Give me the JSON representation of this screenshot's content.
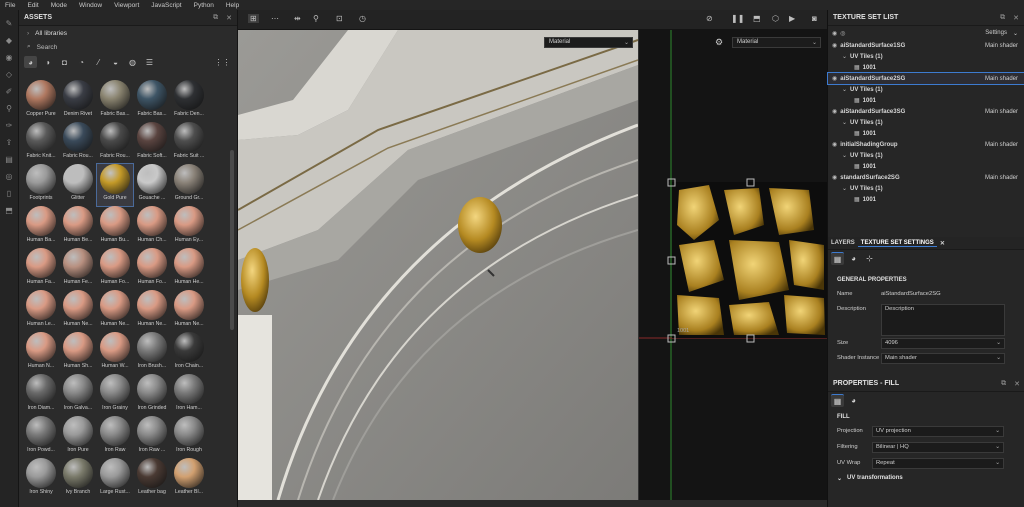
{
  "menu": [
    "File",
    "Edit",
    "Mode",
    "Window",
    "Viewport",
    "JavaScript",
    "Python",
    "Help"
  ],
  "assets": {
    "title": "ASSETS",
    "libraries_label": "All libraries",
    "search_placeholder": "Search",
    "materials": [
      {
        "label": "Copper Pure",
        "color": "#b07860"
      },
      {
        "label": "Denim Rivet",
        "color": "#3a3d45"
      },
      {
        "label": "Fabric Bas...",
        "color": "#8a8470"
      },
      {
        "label": "Fabric Bas...",
        "color": "#3e5566"
      },
      {
        "label": "Fabric Den...",
        "color": "#2e3033"
      },
      {
        "label": "Fabric Knit...",
        "color": "#5a5a5a"
      },
      {
        "label": "Fabric Rou...",
        "color": "#3a4a5a"
      },
      {
        "label": "Fabric Rou...",
        "color": "#4a4a4a"
      },
      {
        "label": "Fabric Soft...",
        "color": "#5a4440"
      },
      {
        "label": "Fabric Suit ...",
        "color": "#4e4e4e"
      },
      {
        "label": "Footprints",
        "color": "#9a9a9a"
      },
      {
        "label": "Glitter",
        "color": "#bdbdbd"
      },
      {
        "label": "Gold Pure",
        "color": "#c49a28",
        "selected": true
      },
      {
        "label": "Gouache ...",
        "color": "#c9c9c9"
      },
      {
        "label": "Ground Gr...",
        "color": "#8a8278"
      },
      {
        "label": "Human Ba...",
        "color": "#d99a84"
      },
      {
        "label": "Human Be...",
        "color": "#d99a84"
      },
      {
        "label": "Human Bu...",
        "color": "#d99a84"
      },
      {
        "label": "Human Ch...",
        "color": "#d99a84"
      },
      {
        "label": "Human Ey...",
        "color": "#d99a84"
      },
      {
        "label": "Human Fa...",
        "color": "#d99a84"
      },
      {
        "label": "Human Fe...",
        "color": "#b89080"
      },
      {
        "label": "Human Fo...",
        "color": "#d99a84"
      },
      {
        "label": "Human Fo...",
        "color": "#d99a84"
      },
      {
        "label": "Human He...",
        "color": "#d99a84"
      },
      {
        "label": "Human Le...",
        "color": "#d99a84"
      },
      {
        "label": "Human Ne...",
        "color": "#d99a84"
      },
      {
        "label": "Human Ne...",
        "color": "#d99a84"
      },
      {
        "label": "Human Ne...",
        "color": "#d99a84"
      },
      {
        "label": "Human Ne...",
        "color": "#d99a84"
      },
      {
        "label": "Human N...",
        "color": "#d99a84"
      },
      {
        "label": "Human Sh...",
        "color": "#d99a84"
      },
      {
        "label": "Human W...",
        "color": "#d99a84"
      },
      {
        "label": "Iron Brush...",
        "color": "#7a7a7a"
      },
      {
        "label": "Iron Chain...",
        "color": "#3a3a3a"
      },
      {
        "label": "Iron Diam...",
        "color": "#6a6a6a"
      },
      {
        "label": "Iron Galva...",
        "color": "#8a8a8a"
      },
      {
        "label": "Iron Grainy",
        "color": "#8a8a8a"
      },
      {
        "label": "Iron Grinded",
        "color": "#8a8a8a"
      },
      {
        "label": "Iron Ham...",
        "color": "#7a7a7a"
      },
      {
        "label": "Iron Powd...",
        "color": "#7a7a7a"
      },
      {
        "label": "Iron Pure",
        "color": "#9a9a9a"
      },
      {
        "label": "Iron Raw",
        "color": "#8a8a8a"
      },
      {
        "label": "Iron Raw ...",
        "color": "#8a8a8a"
      },
      {
        "label": "Iron Rough",
        "color": "#8a8a8a"
      },
      {
        "label": "Iron Shiny",
        "color": "#9a9a9a"
      },
      {
        "label": "Ivy Branch",
        "color": "#7a7a6a"
      },
      {
        "label": "Large Rust...",
        "color": "#9a9a9a"
      },
      {
        "label": "Leather bag",
        "color": "#4a3a33"
      },
      {
        "label": "Leather Bl...",
        "color": "#d2a070"
      }
    ]
  },
  "viewport": {
    "mode_3d": "Material",
    "mode_2d": "Material",
    "uv_label": "1001"
  },
  "texture_set_list": {
    "title": "TEXTURE SET LIST",
    "settings_label": "Settings",
    "sets": [
      {
        "name": "aiStandardSurface1SG",
        "shader": "Main shader",
        "tiles": "UV Tiles (1)",
        "tile": "1001"
      },
      {
        "name": "aiStandardSurface2SG",
        "shader": "Main shader",
        "tiles": "UV Tiles (1)",
        "tile": "1001",
        "selected": true
      },
      {
        "name": "aiStandardSurface3SG",
        "shader": "Main shader",
        "tiles": "UV Tiles (1)",
        "tile": "1001"
      },
      {
        "name": "initialShadingGroup",
        "shader": "Main shader",
        "tiles": "UV Tiles (1)",
        "tile": "1001"
      },
      {
        "name": "standardSurface2SG",
        "shader": "Main shader",
        "tiles": "UV Tiles (1)",
        "tile": "1001"
      }
    ]
  },
  "settings_panel": {
    "tab_layers": "LAYERS",
    "tab_tss": "TEXTURE SET SETTINGS",
    "section": "GENERAL PROPERTIES",
    "name_label": "Name",
    "name_value": "aiStandardSurface2SG",
    "desc_label": "Description",
    "desc_value": "Description",
    "size_label": "Size",
    "size_value": "4096",
    "shader_label": "Shader Instance",
    "shader_value": "Main shader"
  },
  "fill_panel": {
    "title": "PROPERTIES - FILL",
    "section": "FILL",
    "projection_label": "Projection",
    "projection_value": "UV projection",
    "filtering_label": "Filtering",
    "filtering_value": "Bilinear | HQ",
    "uvwrap_label": "UV Wrap",
    "uvwrap_value": "Repeat",
    "uvtransform_label": "UV transformations"
  }
}
